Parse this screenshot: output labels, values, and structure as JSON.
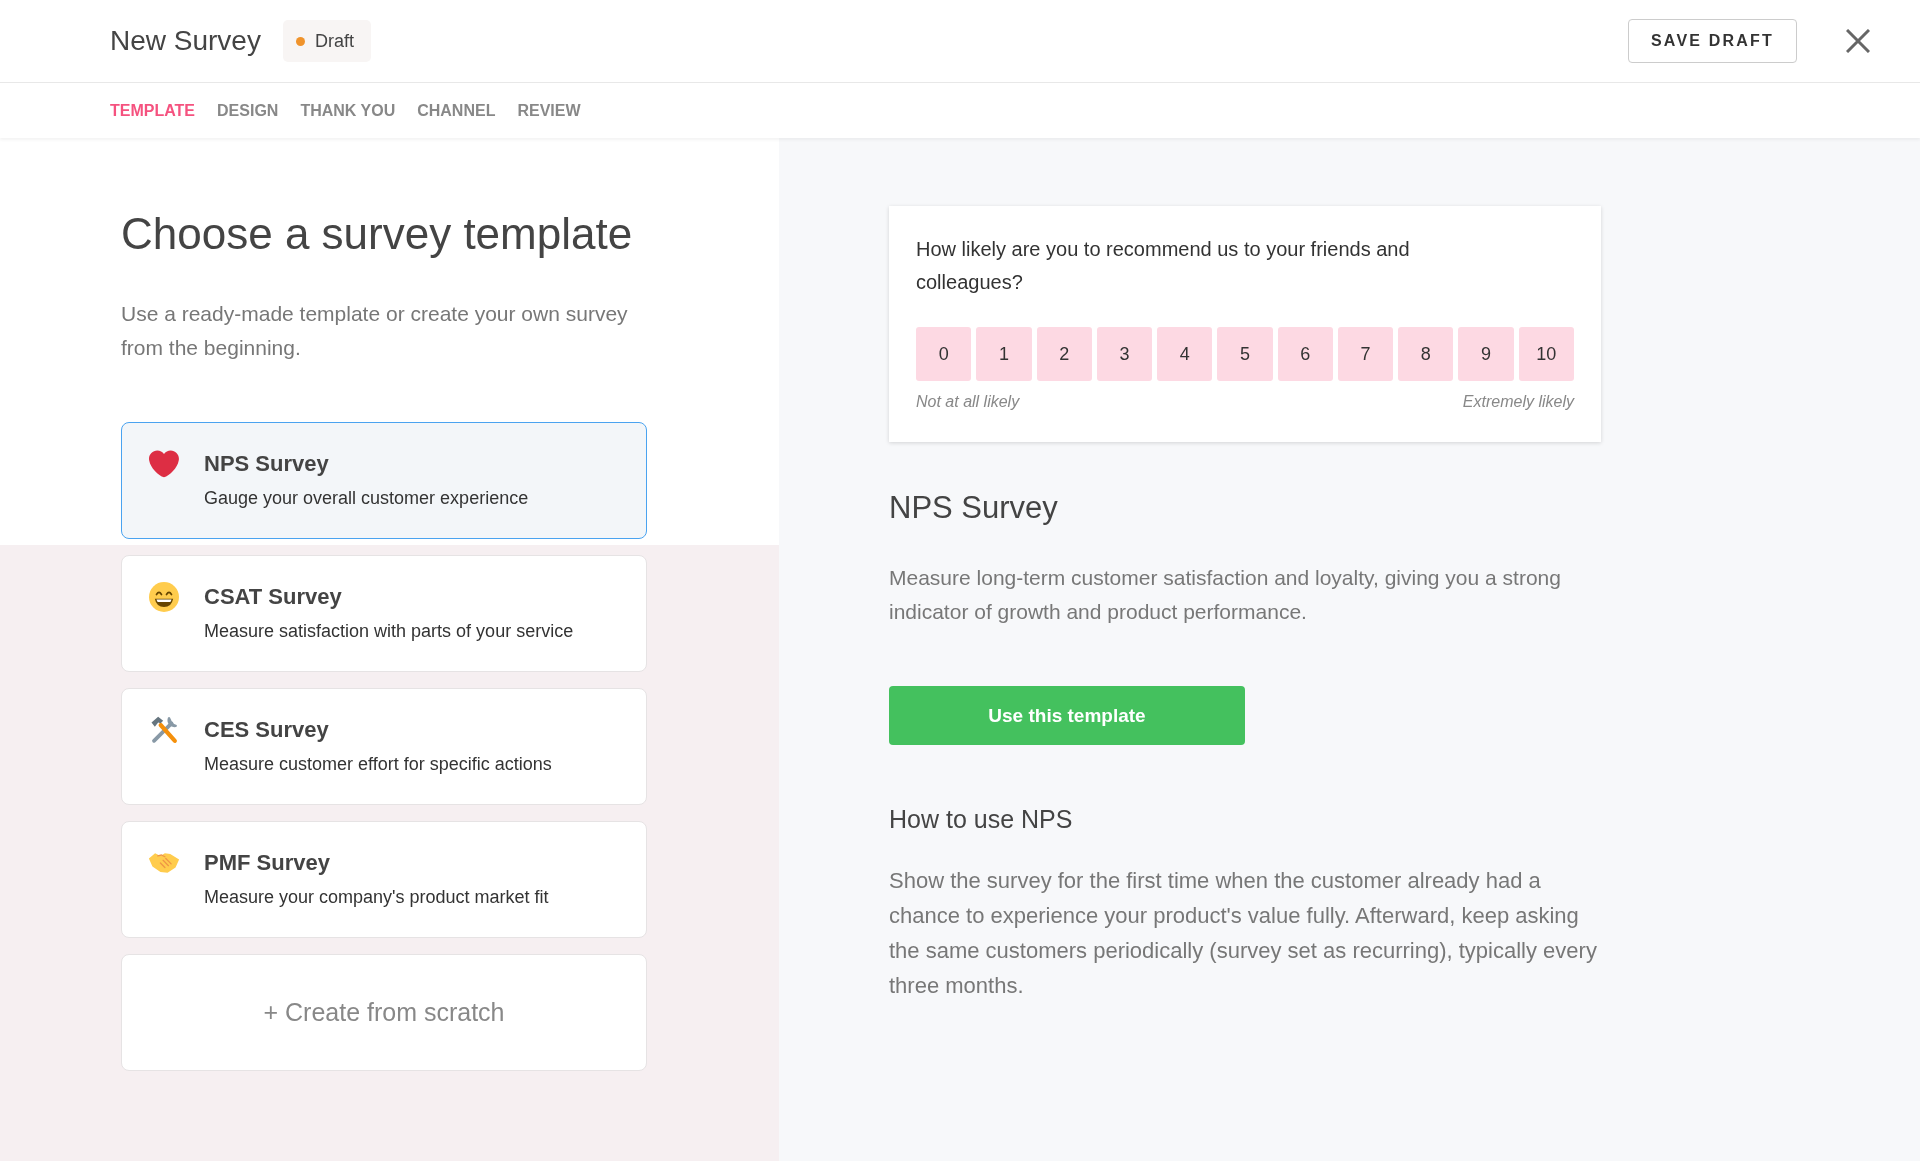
{
  "header": {
    "title": "New Survey",
    "status": "Draft",
    "save_button": "SAVE DRAFT"
  },
  "tabs": [
    {
      "label": "TEMPLATE",
      "selected": true
    },
    {
      "label": "DESIGN",
      "selected": false
    },
    {
      "label": "THANK YOU",
      "selected": false
    },
    {
      "label": "CHANNEL",
      "selected": false
    },
    {
      "label": "REVIEW",
      "selected": false
    }
  ],
  "templates_panel": {
    "title": "Choose a survey template",
    "subtitle": "Use a ready-made template or create your own survey from the beginning.",
    "templates": [
      {
        "title": "NPS Survey",
        "description": "Gauge your overall customer experience",
        "selected": true
      },
      {
        "title": "CSAT Survey",
        "description": "Measure satisfaction with parts of your service",
        "selected": false
      },
      {
        "title": "CES Survey",
        "description": "Measure customer effort for specific actions",
        "selected": false
      },
      {
        "title": "PMF Survey",
        "description": "Measure your company's product market fit",
        "selected": false
      }
    ],
    "create_button": "+ Create from scratch"
  },
  "preview": {
    "question": "How likely are you to recommend us to your friends and colleagues?",
    "scale": [
      "0",
      "1",
      "2",
      "3",
      "4",
      "5",
      "6",
      "7",
      "8",
      "9",
      "10"
    ],
    "low_label": "Not at all likely",
    "high_label": "Extremely likely"
  },
  "details": {
    "title": "NPS Survey",
    "description": "Measure long-term customer satisfaction and loyalty, giving you a strong indicator of growth and product performance.",
    "button": "Use this template",
    "howto_title": "How to use NPS",
    "howto_text": "Show the survey for the first time when the customer already had a chance to experience your product's value fully. Afterward, keep asking the same customers periodically (survey set as recurring), typically every three months."
  }
}
